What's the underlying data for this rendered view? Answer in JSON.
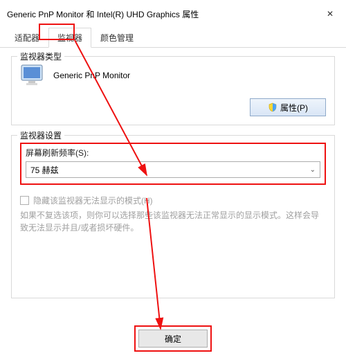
{
  "titlebar": {
    "title": "Generic PnP Monitor 和 Intel(R) UHD Graphics 属性"
  },
  "tabs": {
    "adapter": "适配器",
    "monitor": "监视器",
    "color": "颜色管理"
  },
  "group_type": {
    "title": "监视器类型",
    "monitor_name": "Generic PnP Monitor",
    "properties_button": "属性(P)"
  },
  "group_settings": {
    "title": "监视器设置",
    "refresh_label": "屏幕刷新频率(S):",
    "refresh_value": "75 赫兹",
    "hide_modes_label": "隐藏该监视器无法显示的模式(H)",
    "hide_modes_hint": "如果不复选该项，则你可以选择那些该监视器无法正常显示的显示模式。这样会导致无法显示并且/或者损坏硬件。"
  },
  "buttons": {
    "ok": "确定"
  },
  "icons": {
    "close": "✕",
    "chevron_down": "⌄"
  }
}
